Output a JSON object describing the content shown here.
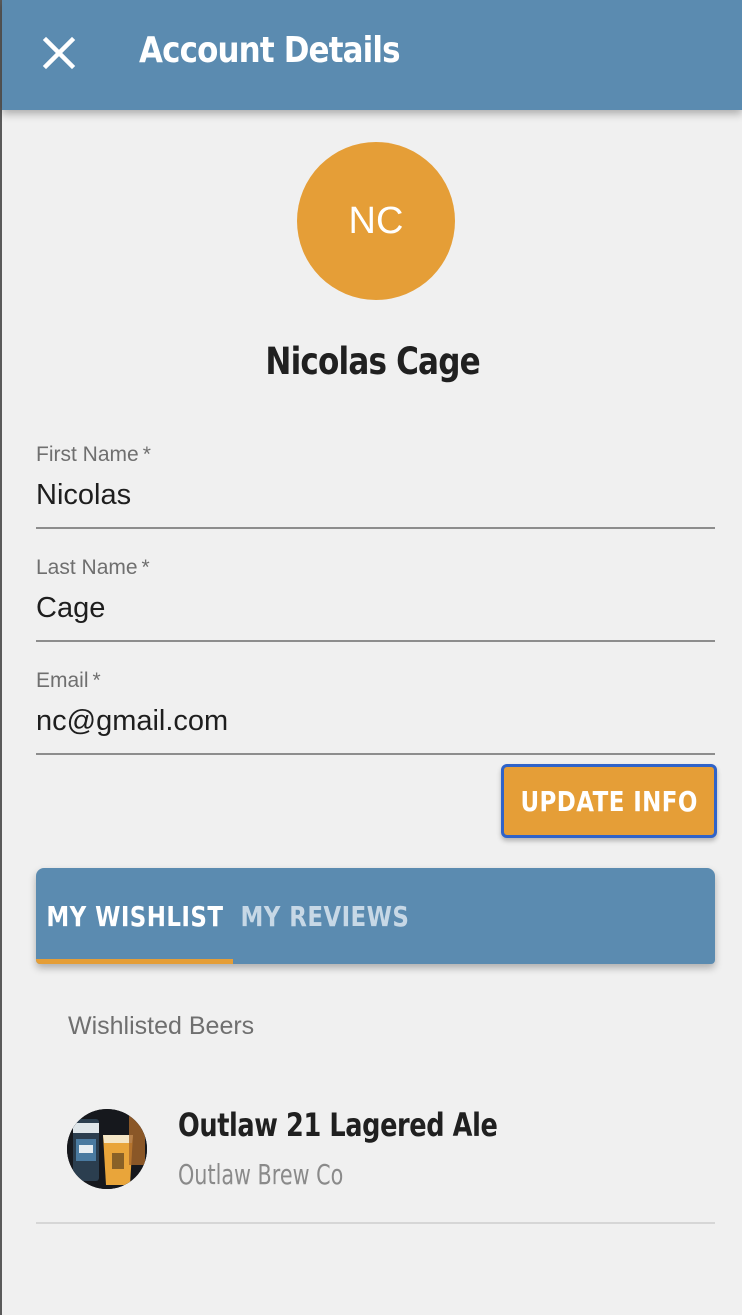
{
  "header": {
    "title": "Account Details",
    "close_icon": "close-icon"
  },
  "profile": {
    "initials": "NC",
    "full_name": "Nicolas Cage",
    "avatar_color": "#e59e37"
  },
  "form": {
    "first_name": {
      "label": "First Name",
      "required_mark": "*",
      "value": "Nicolas"
    },
    "last_name": {
      "label": "Last Name",
      "required_mark": "*",
      "value": "Cage"
    },
    "email": {
      "label": "Email",
      "required_mark": "*",
      "value": "nc@gmail.com"
    },
    "update_button": "UPDATE INFO"
  },
  "tabs": {
    "items": [
      {
        "label": "MY WISHLIST",
        "active": true
      },
      {
        "label": "MY REVIEWS",
        "active": false
      }
    ]
  },
  "wishlist": {
    "heading": "Wishlisted Beers",
    "beers": [
      {
        "name": "Outlaw 21 Lagered Ale",
        "brewery": "Outlaw Brew Co",
        "image_icon": "beer-image"
      }
    ]
  },
  "colors": {
    "primary": "#5b8bb0",
    "accent": "#e59e37",
    "focus_outline": "#2f63c9",
    "background": "#f0f0f0"
  }
}
